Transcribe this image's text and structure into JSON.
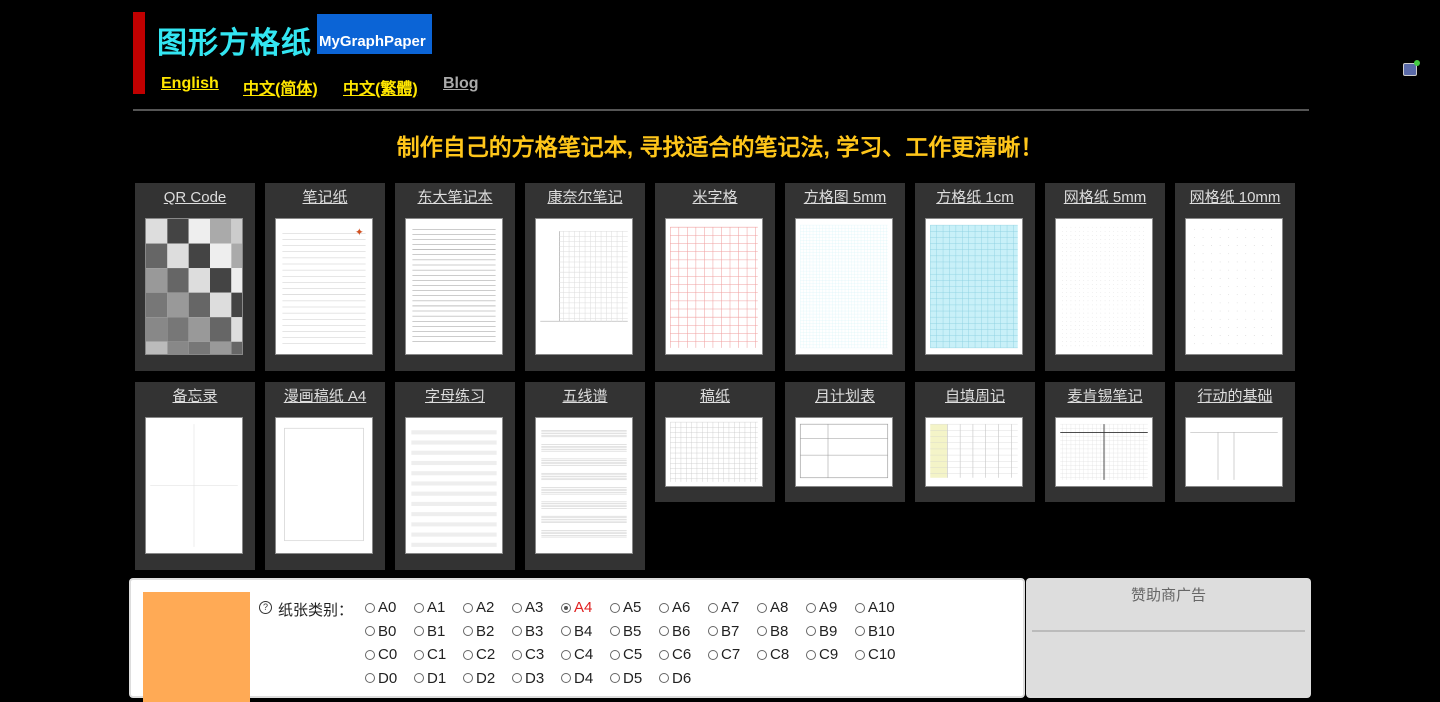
{
  "header": {
    "logo_cn": "图形方格纸",
    "logo_en": "MyGraphPaper",
    "langs": [
      "English",
      "中文(简体)",
      "中文(繁體)",
      "Blog"
    ]
  },
  "slogan": "制作自己的方格笔记本, 寻找适合的笔记法, 学习、工作更清晰！",
  "cards_row1": [
    "QR Code",
    "笔记纸",
    "东大笔记本",
    "康奈尔笔记",
    "米字格",
    "方格图 5mm",
    "方格纸 1cm",
    "网格纸 5mm",
    "网格纸 10mm"
  ],
  "cards_row2": [
    "备忘录",
    "漫画稿纸 A4",
    "字母练习",
    "五线谱",
    "稿纸",
    "月计划表",
    "自填周记",
    "麦肯锡笔记",
    "行动的基础"
  ],
  "paper": {
    "help": "?",
    "label": "纸张类别：",
    "selected": "A4",
    "rows": [
      [
        "A0",
        "A1",
        "A2",
        "A3",
        "A4",
        "A5",
        "A6",
        "A7",
        "A8",
        "A9",
        "A10"
      ],
      [
        "B0",
        "B1",
        "B2",
        "B3",
        "B4",
        "B5",
        "B6",
        "B7",
        "B8",
        "B9",
        "B10"
      ],
      [
        "C0",
        "C1",
        "C2",
        "C3",
        "C4",
        "C5",
        "C6",
        "C7",
        "C8",
        "C9",
        "C10"
      ],
      [
        "D0",
        "D1",
        "D2",
        "D3",
        "D4",
        "D5",
        "D6"
      ]
    ]
  },
  "ad": {
    "title": "赞助商广告"
  },
  "colors": {
    "accent": "#33e6f2",
    "slogan": "#ffc61a",
    "lang": "#ffe600",
    "brand_bar": "#c00000"
  }
}
